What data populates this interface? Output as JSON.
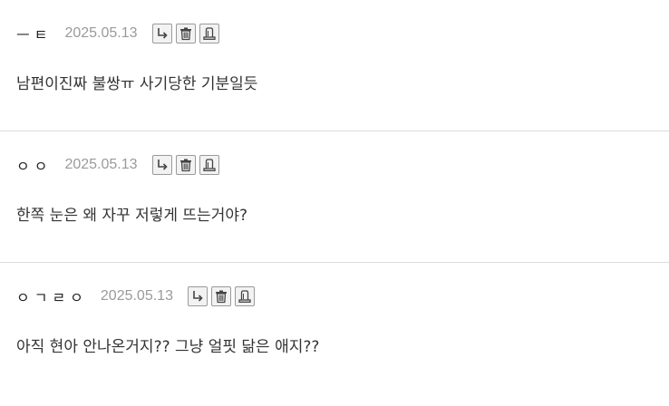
{
  "comments": [
    {
      "author": "ㅡㅌ",
      "date": "2025.05.13",
      "text": "남편이진짜 불쌍ㅠ 사기당한 기분일듯",
      "actions": [
        "reply-icon",
        "delete-icon",
        "report-icon"
      ]
    },
    {
      "author": "ㅇㅇ",
      "date": "2025.05.13",
      "text": "한쪽 눈은 왜 자꾸 저렇게 뜨는거야?",
      "actions": [
        "reply-icon",
        "delete-icon",
        "report-icon"
      ]
    },
    {
      "author": "ㅇㄱㄹㅇ",
      "date": "2025.05.13",
      "text": "아직 현아 안나온거지?? 그냥 얼핏 닮은 애지??",
      "actions": [
        "reply-icon",
        "delete-icon",
        "report-icon"
      ]
    }
  ],
  "colors": {
    "date": "#9a9a9a",
    "divider": "#dcdcdc",
    "text": "#333333",
    "button_border": "#9a9a9a",
    "button_bg": "#f2f2f2"
  }
}
